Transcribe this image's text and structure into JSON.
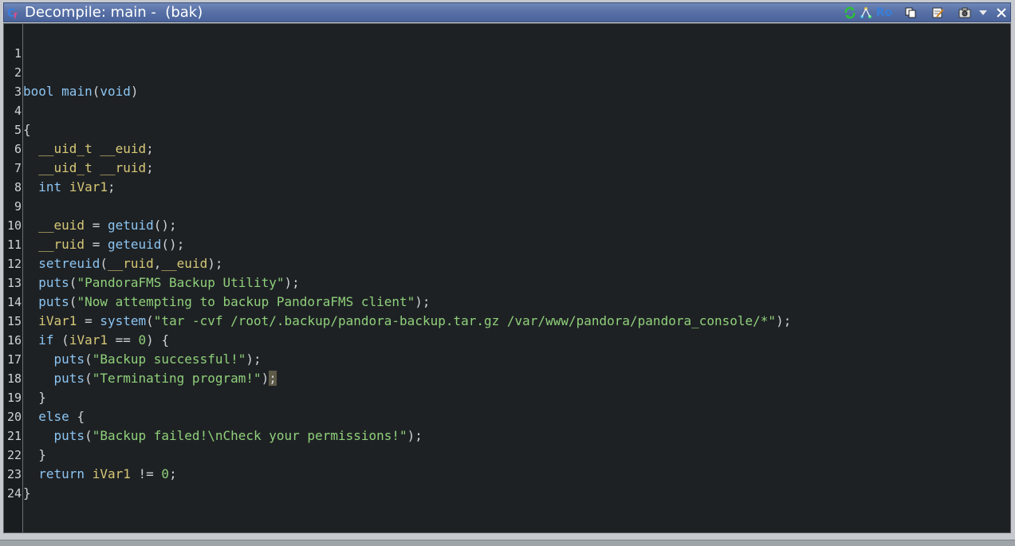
{
  "window": {
    "title": "Decompile: main -  (bak)",
    "ro_label": "Ro"
  },
  "toolbar": {
    "icons": [
      "refresh-icon",
      "graph-icon",
      "copy-icon",
      "edit-icon",
      "snapshot-icon",
      "dropdown-icon",
      "close-icon"
    ]
  },
  "colors": {
    "titlebar": "#566fa5",
    "editor_bg": "#1e2124",
    "keyword": "#8cc5f2",
    "variable": "#d6c876",
    "string": "#8fd07a"
  },
  "code": {
    "line_numbers": [
      "1",
      "2",
      "3",
      "4",
      "5",
      "6",
      "7",
      "8",
      "9",
      "10",
      "11",
      "12",
      "13",
      "14",
      "15",
      "16",
      "17",
      "18",
      "19",
      "20",
      "21",
      "22",
      "23",
      "24"
    ],
    "l2_type": "bool",
    "l2_fn": "main",
    "l2_rest": "(",
    "l2_void": "void",
    "l2_close": ")",
    "l4": "{",
    "l5_type": "__uid_t",
    "l5_var": "__euid",
    "l6_type": "__uid_t",
    "l6_var": "__ruid",
    "l7_type": "int",
    "l7_var": "iVar1",
    "l9_var": "__euid",
    "l9_fn": "getuid",
    "l10_var": "__ruid",
    "l10_fn": "geteuid",
    "l11_fn": "setreuid",
    "l11_a": "__ruid",
    "l11_b": "__euid",
    "l12_fn": "puts",
    "l12_str": "\"PandoraFMS Backup Utility\"",
    "l13_fn": "puts",
    "l13_str": "\"Now attempting to backup PandoraFMS client\"",
    "l14_var": "iVar1",
    "l14_fn": "system",
    "l14_str": "\"tar -cvf /root/.backup/pandora-backup.tar.gz /var/www/pandora/pandora_console/*\"",
    "l15_kw": "if",
    "l15_var": "iVar1",
    "l15_num": "0",
    "l16_fn": "puts",
    "l16_str": "\"Backup successful!\"",
    "l17_fn": "puts",
    "l17_str": "\"Terminating program!\"",
    "l18": "}",
    "l19_kw": "else",
    "l20_fn": "puts",
    "l20_str": "\"Backup failed!\\nCheck your permissions!\"",
    "l21": "}",
    "l22_kw": "return",
    "l22_var": "iVar1",
    "l22_num": "0",
    "l23": "}"
  }
}
